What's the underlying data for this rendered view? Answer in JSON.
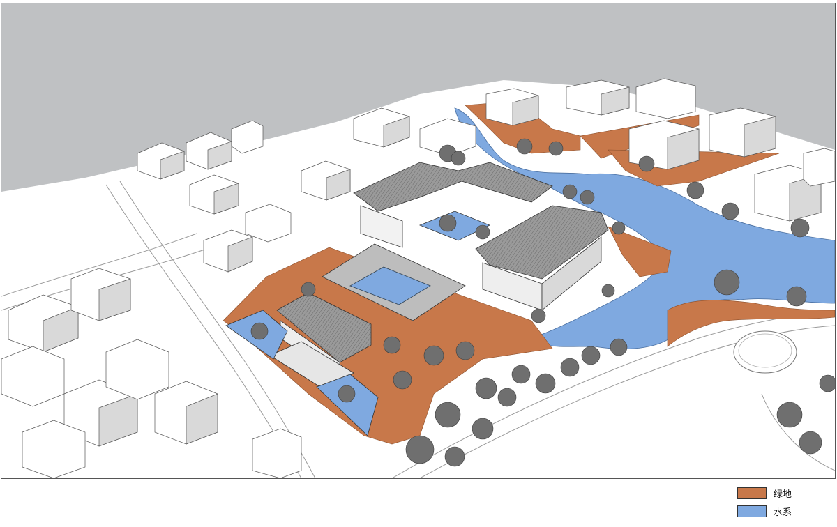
{
  "colors": {
    "sky": "#bfc1c3",
    "ground": "#ffffff",
    "green_space": "#c8784a",
    "water": "#7fa9e0",
    "roof": "#8e8e8e",
    "building_side": "#d9d9d9",
    "tree": "#6f6f6f"
  },
  "legend": {
    "items": [
      {
        "label": "绿地",
        "color": "#c8784a"
      },
      {
        "label": "水系",
        "color": "#7fa9e0"
      }
    ]
  }
}
